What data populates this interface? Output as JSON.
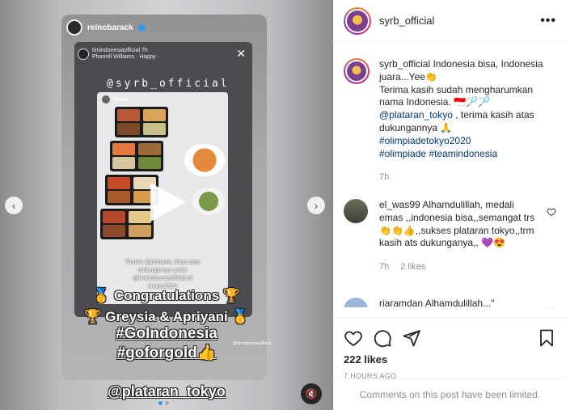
{
  "story": {
    "user": "reinobarack",
    "inner_user": "timindonesiaofficial",
    "inner_time": "7h",
    "inner_music": "Pharrell Williams · Happy ·",
    "mention_top": "@syrb_official",
    "photo_user": "fjkono",
    "photo_caption_1": "Thanks @plataran_tokyo atas",
    "photo_caption_2": "dukungannya untuk",
    "photo_caption_3": "@timindonesiaofficial di",
    "photo_caption_4": "#tokyo2020",
    "line1": "Congratulations",
    "line2": "Greysia & Apriyani",
    "line3": "#GoIndonesia",
    "line4": "#goforgold",
    "mention_bottom": "@plataran_tokyo",
    "sticker": "@timindonesiaofficial",
    "trophy_glyph": "🏆",
    "medal_glyph": "🥇"
  },
  "post": {
    "username": "syrb_official",
    "more_glyph": "•••",
    "caption_user": "syrb_official",
    "caption_1": " Indonesia bisa, Indonesia juara...Yee👏",
    "caption_2": "Terima kasih sudah mengharumkan nama Indonesia. 🇮🇩🏸🏸",
    "caption_mention": "@plataran_tokyo",
    "caption_3": " , terima kasih atas dukungannya 🙏",
    "hashtag_1": "#olimpiadetokyo2020",
    "hashtag_2": "#olimpiade",
    "hashtag_3": "#teamindonesia",
    "caption_time": "7h",
    "likes": "222 likes",
    "ago": "7 HOURS AGO",
    "footer": "Comments on this post have been limited."
  },
  "comments": [
    {
      "user": "el_was99",
      "text": " Alhamdulillah, medali emas ,,indonesia bisa,,semangat trs👏👏👍,,sukses plataran tokyo,,trm kasih ats dukunganya,, 💜😍",
      "time": "7h",
      "likes": "2 likes"
    },
    {
      "user": "riaramdan",
      "text": " Alhamdulillah...\""
    }
  ],
  "colors": {
    "link": "#00376b",
    "muted": "#8e8e8e",
    "accent": "#3897f0"
  }
}
